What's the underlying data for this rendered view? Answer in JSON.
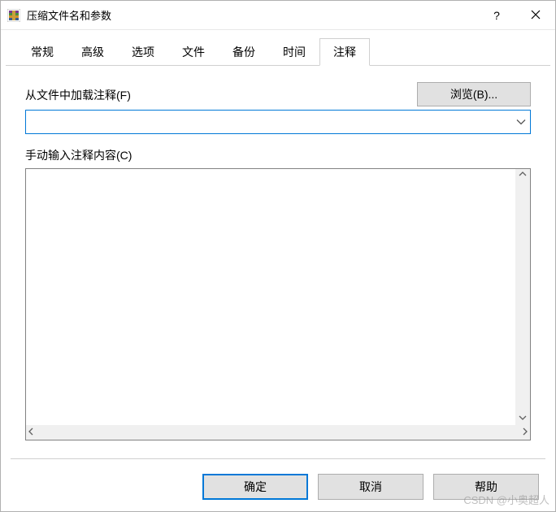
{
  "titlebar": {
    "title": "压缩文件名和参数"
  },
  "tabs": {
    "items": [
      {
        "label": "常规"
      },
      {
        "label": "高级"
      },
      {
        "label": "选项"
      },
      {
        "label": "文件"
      },
      {
        "label": "备份"
      },
      {
        "label": "时间"
      },
      {
        "label": "注释"
      }
    ],
    "active_index": 6
  },
  "content": {
    "load_label": "从文件中加载注释(F)",
    "browse_label": "浏览(B)...",
    "combo_value": "",
    "manual_label": "手动输入注释内容(C)",
    "textarea_value": ""
  },
  "footer": {
    "ok": "确定",
    "cancel": "取消",
    "help": "帮助"
  },
  "watermark": "CSDN @小奥超人"
}
